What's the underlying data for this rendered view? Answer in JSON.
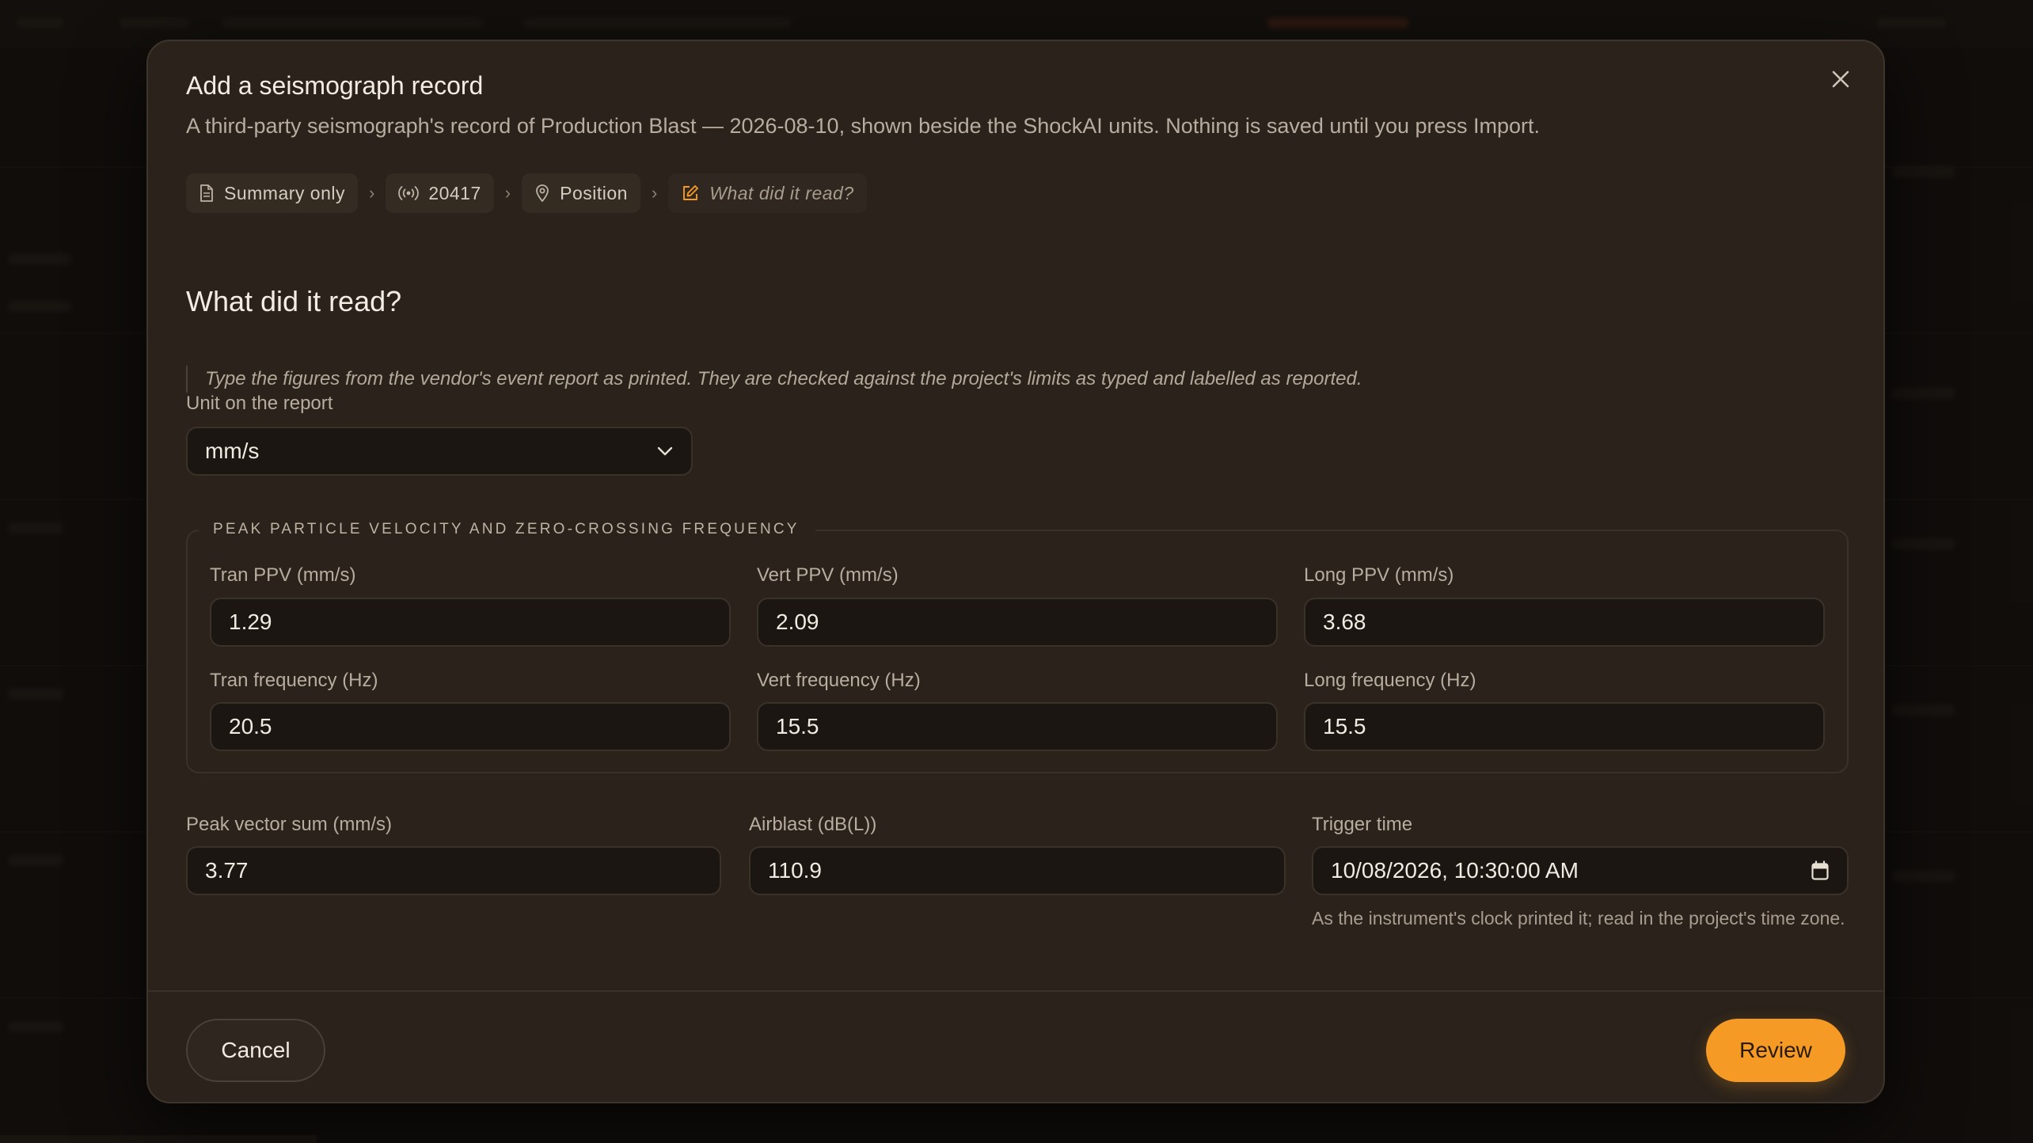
{
  "dialog": {
    "title": "Add a seismograph record",
    "description": "A third-party seismograph's record of Production Blast — 2026-08-10, shown beside the ShockAI units. Nothing is saved until you press Import.",
    "close_icon": "close-icon"
  },
  "breadcrumb": {
    "separator": "›",
    "steps": [
      {
        "label": "Summary only",
        "icon": "document-icon"
      },
      {
        "label": "20417",
        "icon": "broadcast-icon"
      },
      {
        "label": "Position",
        "icon": "map-pin-icon"
      },
      {
        "label": "What did it read?",
        "icon": "edit-icon"
      }
    ]
  },
  "section": {
    "heading": "What did it read?",
    "note": "Type the figures from the vendor's event report as printed. They are checked against the project's limits as typed and labelled as reported."
  },
  "unit": {
    "label": "Unit on the report",
    "value": "mm/s"
  },
  "ppv_group": {
    "legend": "PEAK PARTICLE VELOCITY AND ZERO-CROSSING FREQUENCY",
    "fields": [
      {
        "label": "Tran PPV (mm/s)",
        "value": "1.29"
      },
      {
        "label": "Vert PPV (mm/s)",
        "value": "2.09"
      },
      {
        "label": "Long PPV (mm/s)",
        "value": "3.68"
      },
      {
        "label": "Tran frequency (Hz)",
        "value": "20.5"
      },
      {
        "label": "Vert frequency (Hz)",
        "value": "15.5"
      },
      {
        "label": "Long frequency (Hz)",
        "value": "15.5"
      }
    ]
  },
  "peak_vector_sum": {
    "label": "Peak vector sum (mm/s)",
    "value": "3.77"
  },
  "airblast": {
    "label": "Airblast (dB(L))",
    "value": "110.9"
  },
  "trigger_time": {
    "label": "Trigger time",
    "value": "10/08/2026, 10:30:00 AM",
    "hint": "As the instrument's clock printed it; read in the project's time zone."
  },
  "footer": {
    "cancel_label": "Cancel",
    "review_label": "Review"
  },
  "colors": {
    "accent": "#f59a24",
    "modal_bg": "#2a221b",
    "field_bg": "#1b1612"
  }
}
